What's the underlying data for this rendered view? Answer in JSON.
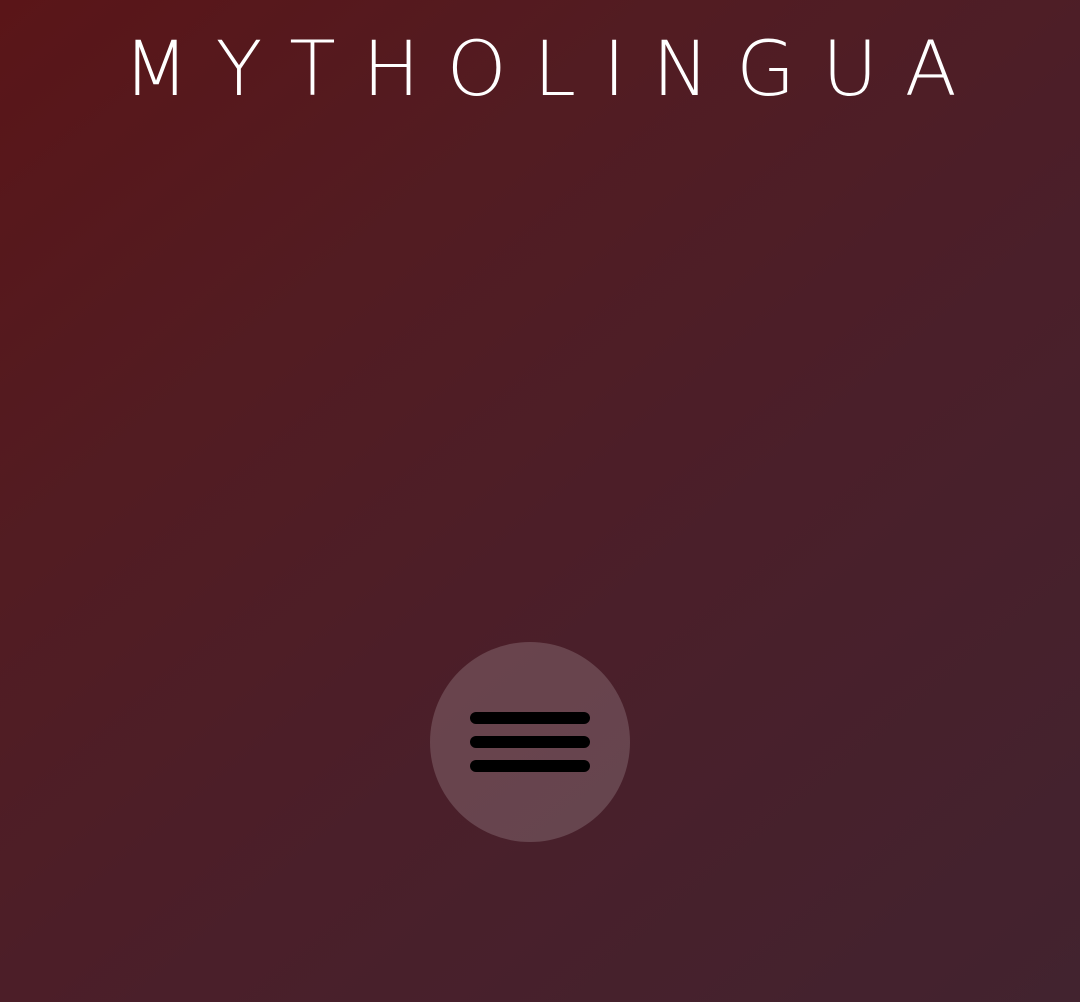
{
  "header": {
    "title": "MYTHOLINGUA"
  },
  "menu_button": {
    "icon": "hamburger-menu-icon"
  },
  "colors": {
    "background_top_left": "#5a1518",
    "background_bottom_right": "#42232f",
    "title_text": "#ffffff",
    "menu_button_fill": "rgba(255,255,255,0.17)",
    "menu_icon": "#000000"
  }
}
